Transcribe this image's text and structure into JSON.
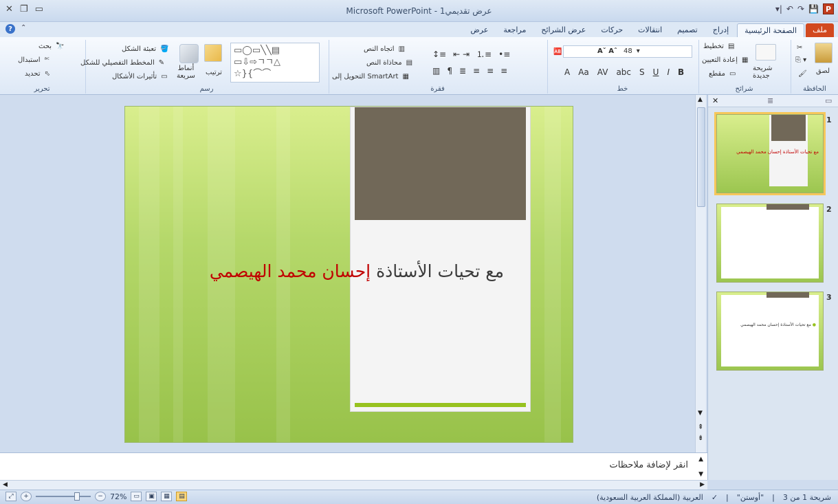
{
  "window": {
    "title": "Microsoft PowerPoint - عرض تقديمي1"
  },
  "tabs": [
    {
      "label": "ملف"
    },
    {
      "label": "الصفحة الرئيسية"
    },
    {
      "label": "إدراج"
    },
    {
      "label": "تصميم"
    },
    {
      "label": "انتقالات"
    },
    {
      "label": "حركات"
    },
    {
      "label": "عرض الشرائح"
    },
    {
      "label": "مراجعة"
    },
    {
      "label": "عرض"
    }
  ],
  "ribbon": {
    "clipboard": {
      "label": "الحافظة",
      "paste": "لصق"
    },
    "slides": {
      "label": "شرائح",
      "new_slide": "شريحة جديدة",
      "layout": "تخطيط",
      "reset": "إعادة التعيين",
      "section": "مقطع"
    },
    "font": {
      "label": "خط",
      "size": "48"
    },
    "paragraph": {
      "label": "فقرة",
      "text_direction": "اتجاه النص",
      "align_text": "محاذاة النص",
      "smartart": "التحويل إلى SmartArt"
    },
    "drawing": {
      "label": "رسم",
      "fill": "تعبئة الشكل",
      "outline": "المخطط التفصيلي للشكل",
      "effects": "تأثيرات الأشكال",
      "arrange": "ترتيب",
      "quick_styles_1": "أنماط",
      "quick_styles_2": "سريعة"
    },
    "editing": {
      "label": "تحرير",
      "find": "بحث",
      "replace": "استبدال",
      "select": "تحديد"
    }
  },
  "slide": {
    "text_black": "مع تحيات الأستاذة",
    "text_red": "إحسان محمد الهيصمي"
  },
  "thumbnails": [
    {
      "num": "1",
      "text": "مع تحيات الأستاذة إحسان محمد الهيصمي"
    },
    {
      "num": "2",
      "text": ""
    },
    {
      "num": "3",
      "text": "مع تحيات الأستاذة إحسان محمد الهيصمي"
    }
  ],
  "notes": {
    "placeholder": "انقر لإضافة ملاحظات"
  },
  "status": {
    "slide_info": "شريحة 1 من 3",
    "theme": "\"أوستن\"",
    "language": "العربية (المملكة العربية السعودية)",
    "zoom": "72%"
  }
}
